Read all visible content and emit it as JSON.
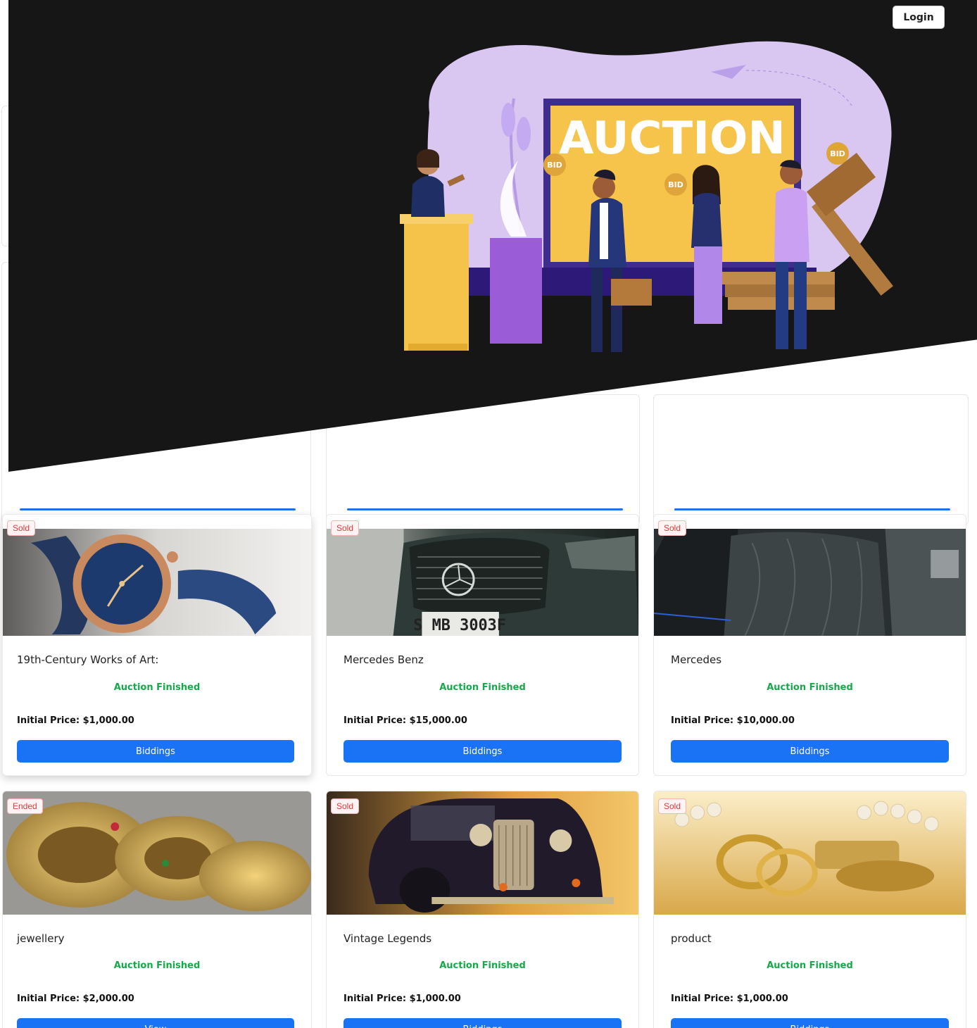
{
  "header": {
    "login_label": "Login"
  },
  "hero": {
    "illustration_text": "AUCTION",
    "bid_sign": "BID"
  },
  "colors": {
    "hero_bg": "#161616",
    "accent": "#1a73f5",
    "status_green": "#17a84a",
    "badge_red": "#e03b3b"
  },
  "products": [
    {
      "badge": "Sold",
      "title": "19th-Century Works of Art:",
      "status": "Auction Finished",
      "price_label": "Initial Price:",
      "price": "$1,000.00",
      "button": "Biddings",
      "image": "watch"
    },
    {
      "badge": "Sold",
      "title": "Mercedes Benz",
      "status": "Auction Finished",
      "price_label": "Initial Price:",
      "price": "$15,000.00",
      "button": "Biddings",
      "image": "car-grille"
    },
    {
      "badge": "Sold",
      "title": "Mercedes",
      "status": "Auction Finished",
      "price_label": "Initial Price:",
      "price": "$10,000.00",
      "button": "Biddings",
      "image": "car-interior"
    },
    {
      "badge": "Ended",
      "title": "jewellery",
      "status": "Auction Finished",
      "price_label": "Initial Price:",
      "price": "$2,000.00",
      "button": "View",
      "image": "gold-bangles"
    },
    {
      "badge": "Sold",
      "title": "Vintage Legends",
      "status": "Auction Finished",
      "price_label": "Initial Price:",
      "price": "$1,000.00",
      "button": "Biddings",
      "image": "vintage-car"
    },
    {
      "badge": "Sold",
      "title": "product",
      "status": "Auction Finished",
      "price_label": "Initial Price:",
      "price": "$1,000.00",
      "button": "Biddings",
      "image": "gold-jewelry"
    }
  ]
}
